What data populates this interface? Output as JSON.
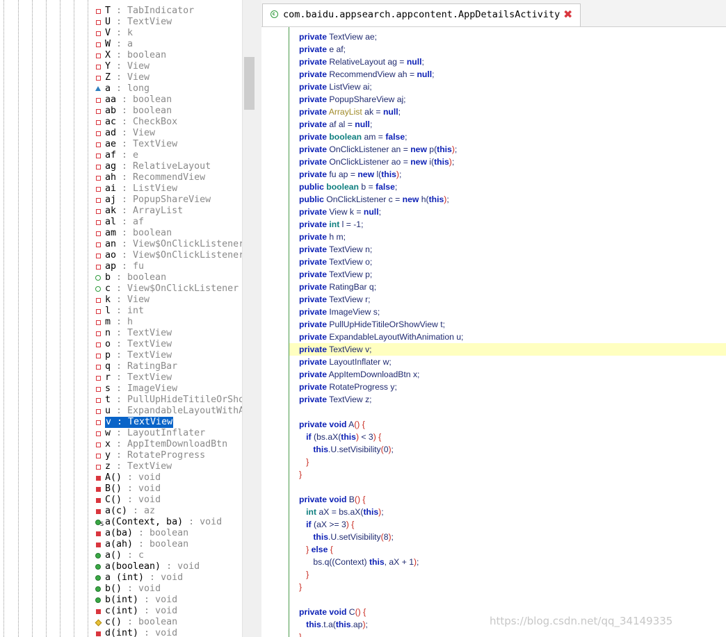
{
  "outline": {
    "items": [
      {
        "name": "T",
        "type": "TabIndicator",
        "icon": "private-field-icon"
      },
      {
        "name": "U",
        "type": "TextView",
        "icon": "private-field-icon"
      },
      {
        "name": "V",
        "type": "k",
        "icon": "private-field-icon"
      },
      {
        "name": "W",
        "type": "a",
        "icon": "private-field-icon"
      },
      {
        "name": "X",
        "type": "boolean",
        "icon": "private-field-icon"
      },
      {
        "name": "Y",
        "type": "View",
        "icon": "private-field-icon"
      },
      {
        "name": "Z",
        "type": "View",
        "icon": "private-field-icon"
      },
      {
        "name": "a",
        "type": "long",
        "icon": "protected-field-icon"
      },
      {
        "name": "aa",
        "type": "boolean",
        "icon": "private-field-icon"
      },
      {
        "name": "ab",
        "type": "boolean",
        "icon": "private-field-icon"
      },
      {
        "name": "ac",
        "type": "CheckBox",
        "icon": "private-field-icon"
      },
      {
        "name": "ad",
        "type": "View",
        "icon": "private-field-icon"
      },
      {
        "name": "ae",
        "type": "TextView",
        "icon": "private-field-icon"
      },
      {
        "name": "af",
        "type": "e",
        "icon": "private-field-icon"
      },
      {
        "name": "ag",
        "type": "RelativeLayout",
        "icon": "private-field-icon"
      },
      {
        "name": "ah",
        "type": "RecommendView",
        "icon": "private-field-icon"
      },
      {
        "name": "ai",
        "type": "ListView",
        "icon": "private-field-icon"
      },
      {
        "name": "aj",
        "type": "PopupShareView",
        "icon": "private-field-icon"
      },
      {
        "name": "ak",
        "type": "ArrayList",
        "icon": "private-field-icon"
      },
      {
        "name": "al",
        "type": "af",
        "icon": "private-field-icon"
      },
      {
        "name": "am",
        "type": "boolean",
        "icon": "private-field-icon"
      },
      {
        "name": "an",
        "type": "View$OnClickListener",
        "icon": "private-field-icon"
      },
      {
        "name": "ao",
        "type": "View$OnClickListener",
        "icon": "private-field-icon"
      },
      {
        "name": "ap",
        "type": "fu",
        "icon": "private-field-icon"
      },
      {
        "name": "b",
        "type": "boolean",
        "icon": "public-field-icon"
      },
      {
        "name": "c",
        "type": "View$OnClickListener",
        "icon": "public-field-icon"
      },
      {
        "name": "k",
        "type": "View",
        "icon": "private-field-icon"
      },
      {
        "name": "l",
        "type": "int",
        "icon": "private-field-icon"
      },
      {
        "name": "m",
        "type": "h",
        "icon": "private-field-icon"
      },
      {
        "name": "n",
        "type": "TextView",
        "icon": "private-field-icon"
      },
      {
        "name": "o",
        "type": "TextView",
        "icon": "private-field-icon"
      },
      {
        "name": "p",
        "type": "TextView",
        "icon": "private-field-icon"
      },
      {
        "name": "q",
        "type": "RatingBar",
        "icon": "private-field-icon"
      },
      {
        "name": "r",
        "type": "TextView",
        "icon": "private-field-icon"
      },
      {
        "name": "s",
        "type": "ImageView",
        "icon": "private-field-icon"
      },
      {
        "name": "t",
        "type": "PullUpHideTitileOrSho",
        "icon": "private-field-icon"
      },
      {
        "name": "u",
        "type": "ExpandableLayoutWithA",
        "icon": "private-field-icon"
      },
      {
        "name": "v",
        "type": "TextView",
        "icon": "private-field-icon",
        "selected": true
      },
      {
        "name": "w",
        "type": "LayoutInflater",
        "icon": "private-field-icon"
      },
      {
        "name": "x",
        "type": "AppItemDownloadBtn",
        "icon": "private-field-icon"
      },
      {
        "name": "y",
        "type": "RotateProgress",
        "icon": "private-field-icon"
      },
      {
        "name": "z",
        "type": "TextView",
        "icon": "private-field-icon"
      },
      {
        "name": "A()",
        "type": "void",
        "icon": "private-method-icon"
      },
      {
        "name": "B()",
        "type": "void",
        "icon": "private-method-icon"
      },
      {
        "name": "C()",
        "type": "void",
        "icon": "private-method-icon"
      },
      {
        "name": "a(c)",
        "type": "az",
        "icon": "private-method-icon"
      },
      {
        "name": "a(Context, ba)",
        "type": "void",
        "icon": "public-static-method-icon"
      },
      {
        "name": "a(ba)",
        "type": "boolean",
        "icon": "private-method-icon"
      },
      {
        "name": "a(ah)",
        "type": "boolean",
        "icon": "private-method-icon"
      },
      {
        "name": "a()",
        "type": "c",
        "icon": "public-method-icon"
      },
      {
        "name": "a(boolean)",
        "type": "void",
        "icon": "public-method-icon"
      },
      {
        "name": "a (int)",
        "type": "void",
        "icon": "public-method-icon"
      },
      {
        "name": "b()",
        "type": "void",
        "icon": "public-method-icon"
      },
      {
        "name": "b(int)",
        "type": "void",
        "icon": "public-method-icon"
      },
      {
        "name": "c(int)",
        "type": "void",
        "icon": "private-method-icon"
      },
      {
        "name": "c()",
        "type": "boolean",
        "icon": "protected-method-icon"
      },
      {
        "name": "d(int)",
        "type": "void",
        "icon": "private-method-icon"
      }
    ]
  },
  "editor": {
    "tab_title": "com.baidu.appsearch.appcontent.AppDetailsActivity",
    "close_glyph": "✖",
    "lines": [
      [
        [
          "k",
          "private"
        ],
        [
          "n",
          " TextView ae;"
        ]
      ],
      [
        [
          "k",
          "private"
        ],
        [
          "n",
          " e af;"
        ]
      ],
      [
        [
          "k",
          "private"
        ],
        [
          "n",
          " RelativeLayout ag = "
        ],
        [
          "k",
          "null"
        ],
        [
          "n",
          ";"
        ]
      ],
      [
        [
          "k",
          "private"
        ],
        [
          "n",
          " RecommendView ah = "
        ],
        [
          "k",
          "null"
        ],
        [
          "n",
          ";"
        ]
      ],
      [
        [
          "k",
          "private"
        ],
        [
          "n",
          " ListView ai;"
        ]
      ],
      [
        [
          "k",
          "private"
        ],
        [
          "n",
          " PopupShareView aj;"
        ]
      ],
      [
        [
          "k",
          "private"
        ],
        [
          "n",
          " "
        ],
        [
          "al",
          "ArrayList"
        ],
        [
          "n",
          " ak = "
        ],
        [
          "k",
          "null"
        ],
        [
          "n",
          ";"
        ]
      ],
      [
        [
          "k",
          "private"
        ],
        [
          "n",
          " af al = "
        ],
        [
          "k",
          "null"
        ],
        [
          "n",
          ";"
        ]
      ],
      [
        [
          "k",
          "private"
        ],
        [
          "n",
          " "
        ],
        [
          "ty",
          "boolean"
        ],
        [
          "n",
          " am = "
        ],
        [
          "k",
          "false"
        ],
        [
          "n",
          ";"
        ]
      ],
      [
        [
          "k",
          "private"
        ],
        [
          "n",
          " OnClickListener an = "
        ],
        [
          "k",
          "new"
        ],
        [
          "n",
          " p("
        ],
        [
          "k",
          "this"
        ],
        [
          "rd",
          ")"
        ],
        [
          "n",
          ";"
        ]
      ],
      [
        [
          "k",
          "private"
        ],
        [
          "n",
          " OnClickListener ao = "
        ],
        [
          "k",
          "new"
        ],
        [
          "n",
          " i("
        ],
        [
          "k",
          "this"
        ],
        [
          "rd",
          ")"
        ],
        [
          "n",
          ";"
        ]
      ],
      [
        [
          "k",
          "private"
        ],
        [
          "n",
          " fu ap = "
        ],
        [
          "k",
          "new"
        ],
        [
          "n",
          " l("
        ],
        [
          "k",
          "this"
        ],
        [
          "rd",
          ")"
        ],
        [
          "n",
          ";"
        ]
      ],
      [
        [
          "k",
          "public"
        ],
        [
          "n",
          " "
        ],
        [
          "ty",
          "boolean"
        ],
        [
          "n",
          " b = "
        ],
        [
          "k",
          "false"
        ],
        [
          "n",
          ";"
        ]
      ],
      [
        [
          "k",
          "public"
        ],
        [
          "n",
          " OnClickListener c = "
        ],
        [
          "k",
          "new"
        ],
        [
          "n",
          " h("
        ],
        [
          "k",
          "this"
        ],
        [
          "rd",
          ")"
        ],
        [
          "n",
          ";"
        ]
      ],
      [
        [
          "k",
          "private"
        ],
        [
          "n",
          " View k = "
        ],
        [
          "k",
          "null"
        ],
        [
          "n",
          ";"
        ]
      ],
      [
        [
          "k",
          "private"
        ],
        [
          "n",
          " "
        ],
        [
          "ty",
          "int"
        ],
        [
          "n",
          " l = -1;"
        ]
      ],
      [
        [
          "k",
          "private"
        ],
        [
          "n",
          " h m;"
        ]
      ],
      [
        [
          "k",
          "private"
        ],
        [
          "n",
          " TextView n;"
        ]
      ],
      [
        [
          "k",
          "private"
        ],
        [
          "n",
          " TextView o;"
        ]
      ],
      [
        [
          "k",
          "private"
        ],
        [
          "n",
          " TextView p;"
        ]
      ],
      [
        [
          "k",
          "private"
        ],
        [
          "n",
          " RatingBar q;"
        ]
      ],
      [
        [
          "k",
          "private"
        ],
        [
          "n",
          " TextView r;"
        ]
      ],
      [
        [
          "k",
          "private"
        ],
        [
          "n",
          " ImageView s;"
        ]
      ],
      [
        [
          "k",
          "private"
        ],
        [
          "n",
          " PullUpHideTitileOrShowView t;"
        ]
      ],
      [
        [
          "k",
          "private"
        ],
        [
          "n",
          " ExpandableLayoutWithAnimation u;"
        ]
      ],
      [
        [
          "k",
          "private"
        ],
        [
          "n",
          " TextView v;"
        ]
      ],
      [
        [
          "k",
          "private"
        ],
        [
          "n",
          " LayoutInflater w;"
        ]
      ],
      [
        [
          "k",
          "private"
        ],
        [
          "n",
          " AppItemDownloadBtn x;"
        ]
      ],
      [
        [
          "k",
          "private"
        ],
        [
          "n",
          " RotateProgress y;"
        ]
      ],
      [
        [
          "k",
          "private"
        ],
        [
          "n",
          " TextView z;"
        ]
      ],
      [],
      [
        [
          "k",
          "private void"
        ],
        [
          "n",
          " A"
        ],
        [
          "rd",
          "() {"
        ]
      ],
      [
        [
          "n",
          "   "
        ],
        [
          "k",
          "if"
        ],
        [
          "n",
          " (bs.aX("
        ],
        [
          "k",
          "this"
        ],
        [
          "rd",
          ")"
        ],
        [
          "n",
          " < 3"
        ],
        [
          "rd",
          ") {"
        ]
      ],
      [
        [
          "n",
          "      "
        ],
        [
          "k",
          "this"
        ],
        [
          "n",
          ".U.setVisibility"
        ],
        [
          "rd",
          "("
        ],
        [
          "n",
          "0"
        ],
        [
          "rd",
          ")"
        ],
        [
          "n",
          ";"
        ]
      ],
      [
        [
          "n",
          "   "
        ],
        [
          "rd",
          "}"
        ]
      ],
      [
        [
          "rd",
          "}"
        ]
      ],
      [],
      [
        [
          "k",
          "private void"
        ],
        [
          "n",
          " B"
        ],
        [
          "rd",
          "() {"
        ]
      ],
      [
        [
          "n",
          "   "
        ],
        [
          "ty",
          "int"
        ],
        [
          "n",
          " aX = bs.aX("
        ],
        [
          "k",
          "this"
        ],
        [
          "rd",
          ")"
        ],
        [
          "n",
          ";"
        ]
      ],
      [
        [
          "n",
          "   "
        ],
        [
          "k",
          "if"
        ],
        [
          "n",
          " (aX >= 3"
        ],
        [
          "rd",
          ") {"
        ]
      ],
      [
        [
          "n",
          "      "
        ],
        [
          "k",
          "this"
        ],
        [
          "n",
          ".U.setVisibility"
        ],
        [
          "rd",
          "("
        ],
        [
          "n",
          "8"
        ],
        [
          "rd",
          ")"
        ],
        [
          "n",
          ";"
        ]
      ],
      [
        [
          "n",
          "   "
        ],
        [
          "rd",
          "} "
        ],
        [
          "k",
          "else"
        ],
        [
          "rd",
          " {"
        ]
      ],
      [
        [
          "n",
          "      bs.q(("
        ],
        [
          "n",
          "Context"
        ],
        [
          "n",
          ") "
        ],
        [
          "k",
          "this"
        ],
        [
          "n",
          ", aX + 1"
        ],
        [
          "rd",
          ")"
        ],
        [
          "n",
          ";"
        ]
      ],
      [
        [
          "n",
          "   "
        ],
        [
          "rd",
          "}"
        ]
      ],
      [
        [
          "rd",
          "}"
        ]
      ],
      [],
      [
        [
          "k",
          "private void"
        ],
        [
          "n",
          " C"
        ],
        [
          "rd",
          "() {"
        ]
      ],
      [
        [
          "n",
          "   "
        ],
        [
          "k",
          "this"
        ],
        [
          "n",
          ".t.a("
        ],
        [
          "k",
          "this"
        ],
        [
          "n",
          ".ap"
        ],
        [
          "rd",
          ")"
        ],
        [
          "n",
          ";"
        ]
      ],
      [
        [
          "rd",
          "}"
        ]
      ]
    ],
    "highlight_line": 25
  },
  "watermark": "https://blog.csdn.net/qq_34149335"
}
